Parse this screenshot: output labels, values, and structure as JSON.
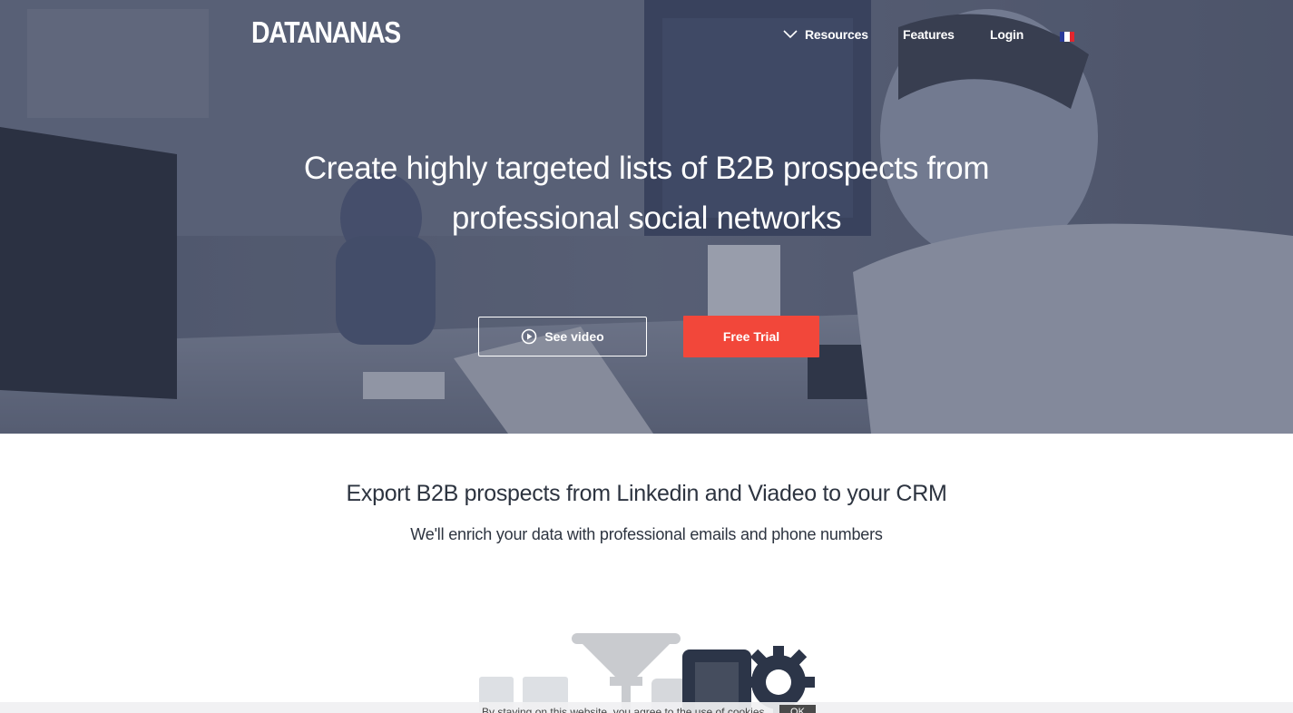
{
  "header": {
    "logo": "DATANANAS",
    "nav": {
      "resources": "Resources",
      "features": "Features",
      "login": "Login"
    },
    "language_flag": "france-flag-icon"
  },
  "hero": {
    "title_line1": "Create highly targeted lists of B2B prospects from",
    "title_line2": "professional social networks",
    "see_video_label": "See video",
    "free_trial_label": "Free Trial"
  },
  "section": {
    "title": "Export B2B prospects from Linkedin and Viadeo to your CRM",
    "subtitle": "We'll enrich your data with professional emails and phone numbers"
  },
  "cookie": {
    "text": "By staying on this website, you agree to the use of cookies.",
    "ok_label": "OK"
  },
  "colors": {
    "accent": "#f2473a",
    "text_dark": "#2d3440",
    "navy": "#2c3548"
  }
}
